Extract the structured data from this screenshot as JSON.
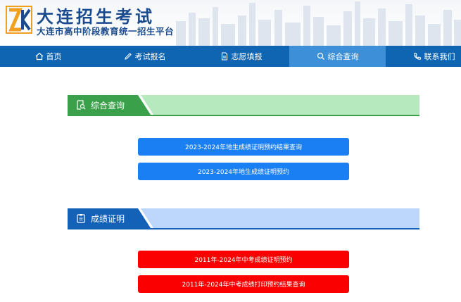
{
  "header": {
    "title": "大连招生考试",
    "subtitle": "大连市高中阶段教育统一招生平台"
  },
  "nav": {
    "items": [
      {
        "label": "首页",
        "icon": "home-icon"
      },
      {
        "label": "考试报名",
        "icon": "pencil-icon"
      },
      {
        "label": "志愿填报",
        "icon": "document-icon"
      },
      {
        "label": "综合查询",
        "icon": "search-icon",
        "active": true
      },
      {
        "label": "联系我们",
        "icon": "phone-icon"
      }
    ]
  },
  "sections": [
    {
      "title": "综合查询",
      "icon": "search-document-icon",
      "color": "#3aa14a",
      "buttons": [
        {
          "label": "2023-2024年地生成绩证明预约结果查询",
          "color": "#1a7ff3"
        },
        {
          "label": "2023-2024年地生成绩证明预约",
          "color": "#1a7ff3"
        }
      ]
    },
    {
      "title": "成绩证明",
      "icon": "clipboard-icon",
      "color": "#1461b8",
      "buttons": [
        {
          "label": "2011年-2024年中考成绩证明预约",
          "color": "#fb0000"
        },
        {
          "label": "2011年-2024年中考成绩打印预约结果查询",
          "color": "#fb0000"
        }
      ]
    }
  ]
}
